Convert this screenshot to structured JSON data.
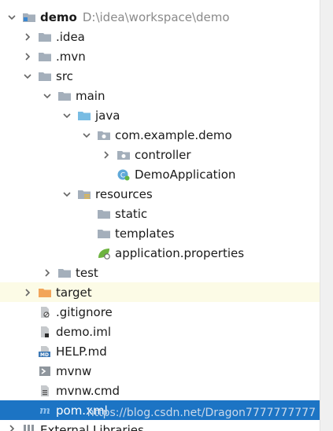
{
  "tree": {
    "root": {
      "label": "demo",
      "path": "D:\\idea\\workspace\\demo"
    },
    "items": [
      {
        "label": ".idea"
      },
      {
        "label": ".mvn"
      },
      {
        "label": "src"
      },
      {
        "label": "main"
      },
      {
        "label": "java"
      },
      {
        "label": "com.example.demo"
      },
      {
        "label": "controller"
      },
      {
        "label": "DemoApplication"
      },
      {
        "label": "resources"
      },
      {
        "label": "static"
      },
      {
        "label": "templates"
      },
      {
        "label": "application.properties"
      },
      {
        "label": "test"
      },
      {
        "label": "target"
      },
      {
        "label": ".gitignore"
      },
      {
        "label": "demo.iml"
      },
      {
        "label": "HELP.md"
      },
      {
        "label": "mvnw"
      },
      {
        "label": "mvnw.cmd"
      },
      {
        "label": "pom.xml"
      },
      {
        "label": "External Libraries"
      }
    ]
  },
  "watermark": "https://blog.csdn.net/Dragon7777777777",
  "colors": {
    "selection": "#1c74c4",
    "excluded_bg": "#fcfbe6",
    "folder": "#a4afbb",
    "source_folder": "#78bce3",
    "excluded_folder": "#f2a55a"
  }
}
